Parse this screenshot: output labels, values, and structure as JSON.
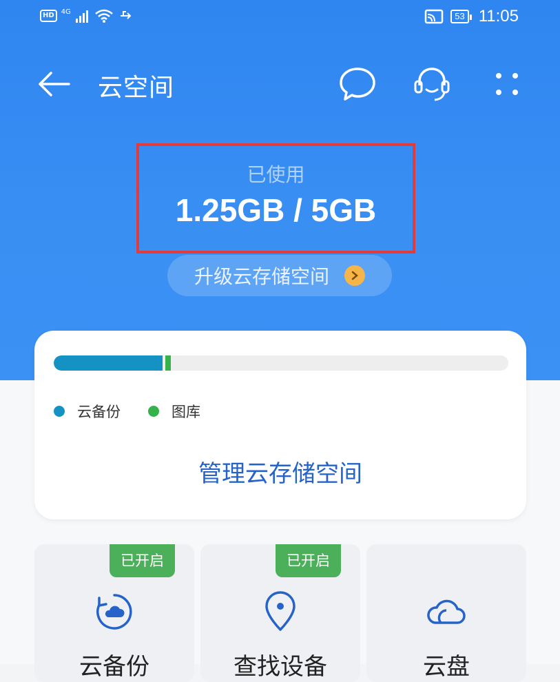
{
  "status_bar": {
    "hd": "HD",
    "network": "4G",
    "battery": "53",
    "time": "11:05",
    "icons": [
      "hd-icon",
      "signal-icon",
      "wifi-icon",
      "usb-icon",
      "cast-icon",
      "battery-icon"
    ]
  },
  "app_bar": {
    "title": "云空间",
    "icons": [
      "back-arrow-icon",
      "message-icon",
      "customer-service-icon",
      "more-icon"
    ]
  },
  "usage": {
    "label": "已使用",
    "value": "1.25GB / 5GB",
    "used_gb": 1.25,
    "total_gb": 5,
    "upgrade_label": "升级云存储空间"
  },
  "storage_card": {
    "segments": [
      {
        "name": "云备份",
        "fraction_of_bar": 0.24,
        "color": "#1592c4"
      },
      {
        "name": "图库",
        "fraction_of_bar": 0.012,
        "color": "#36b24a"
      }
    ],
    "manage_label": "管理云存储空间"
  },
  "tiles": [
    {
      "label": "云备份",
      "badge": "已开启",
      "icon": "cloud-backup-icon"
    },
    {
      "label": "查找设备",
      "badge": "已开启",
      "icon": "location-pin-icon"
    },
    {
      "label": "云盘",
      "badge": "",
      "icon": "cloud-drive-icon"
    }
  ],
  "colors": {
    "header_blue": "#3a8ff3",
    "highlight_red": "#e23b3b",
    "backup_blue": "#1592c4",
    "gallery_green": "#36b24a",
    "link_blue": "#2563c9",
    "badge_green": "#4cb05a"
  }
}
